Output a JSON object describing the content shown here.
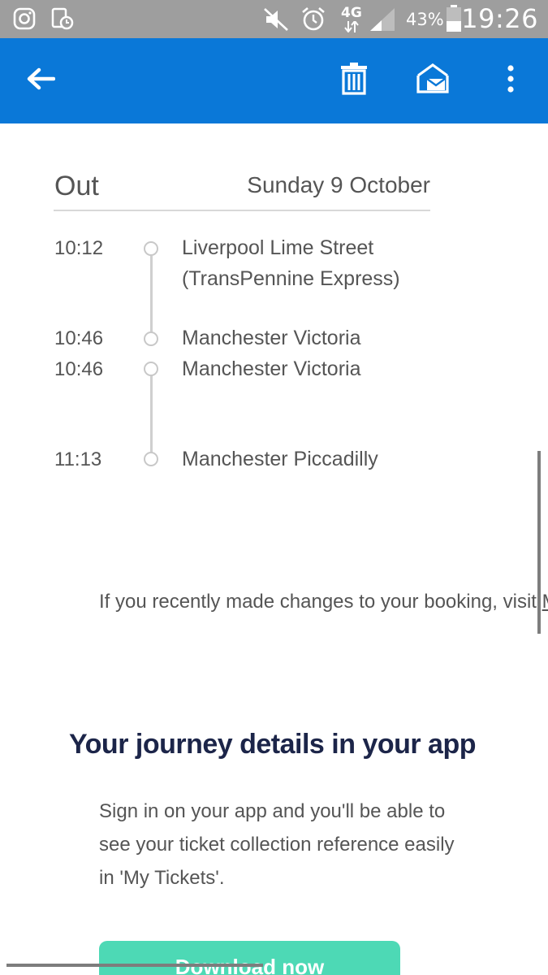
{
  "status_bar": {
    "network": "4G",
    "battery": "43%",
    "time": "19:26",
    "icons": [
      "instagram-icon",
      "notification-icon",
      "mute-icon",
      "alarm-icon",
      "signal-icon",
      "battery-icon"
    ]
  },
  "app_bar": {
    "icons": [
      "back-arrow-icon",
      "delete-icon",
      "mark-read-icon",
      "more-options-icon"
    ],
    "color": "#0a78d8"
  },
  "journey": {
    "leg_title": "Out",
    "date": "Sunday 9 October",
    "stops": [
      {
        "time": "10:12",
        "name": "Liverpool Lime Street",
        "operator": "(TransPennine Express)"
      },
      {
        "time": "10:46",
        "name": "Manchester Victoria"
      },
      {
        "time": "10:46",
        "name": "Manchester Victoria"
      },
      {
        "time": "11:13",
        "name": "Manchester Piccadilly"
      }
    ]
  },
  "notice": {
    "text": "If you recently made changes to your booking, visit ",
    "link": "M"
  },
  "app_section": {
    "heading": "Your journey details in your app",
    "body": "Sign in on your app and you'll be able to see your ticket collection reference easily in 'My Tickets'.",
    "button_label": "Download now",
    "button_color": "#4dd9b5",
    "heading_color": "#1c2549"
  }
}
